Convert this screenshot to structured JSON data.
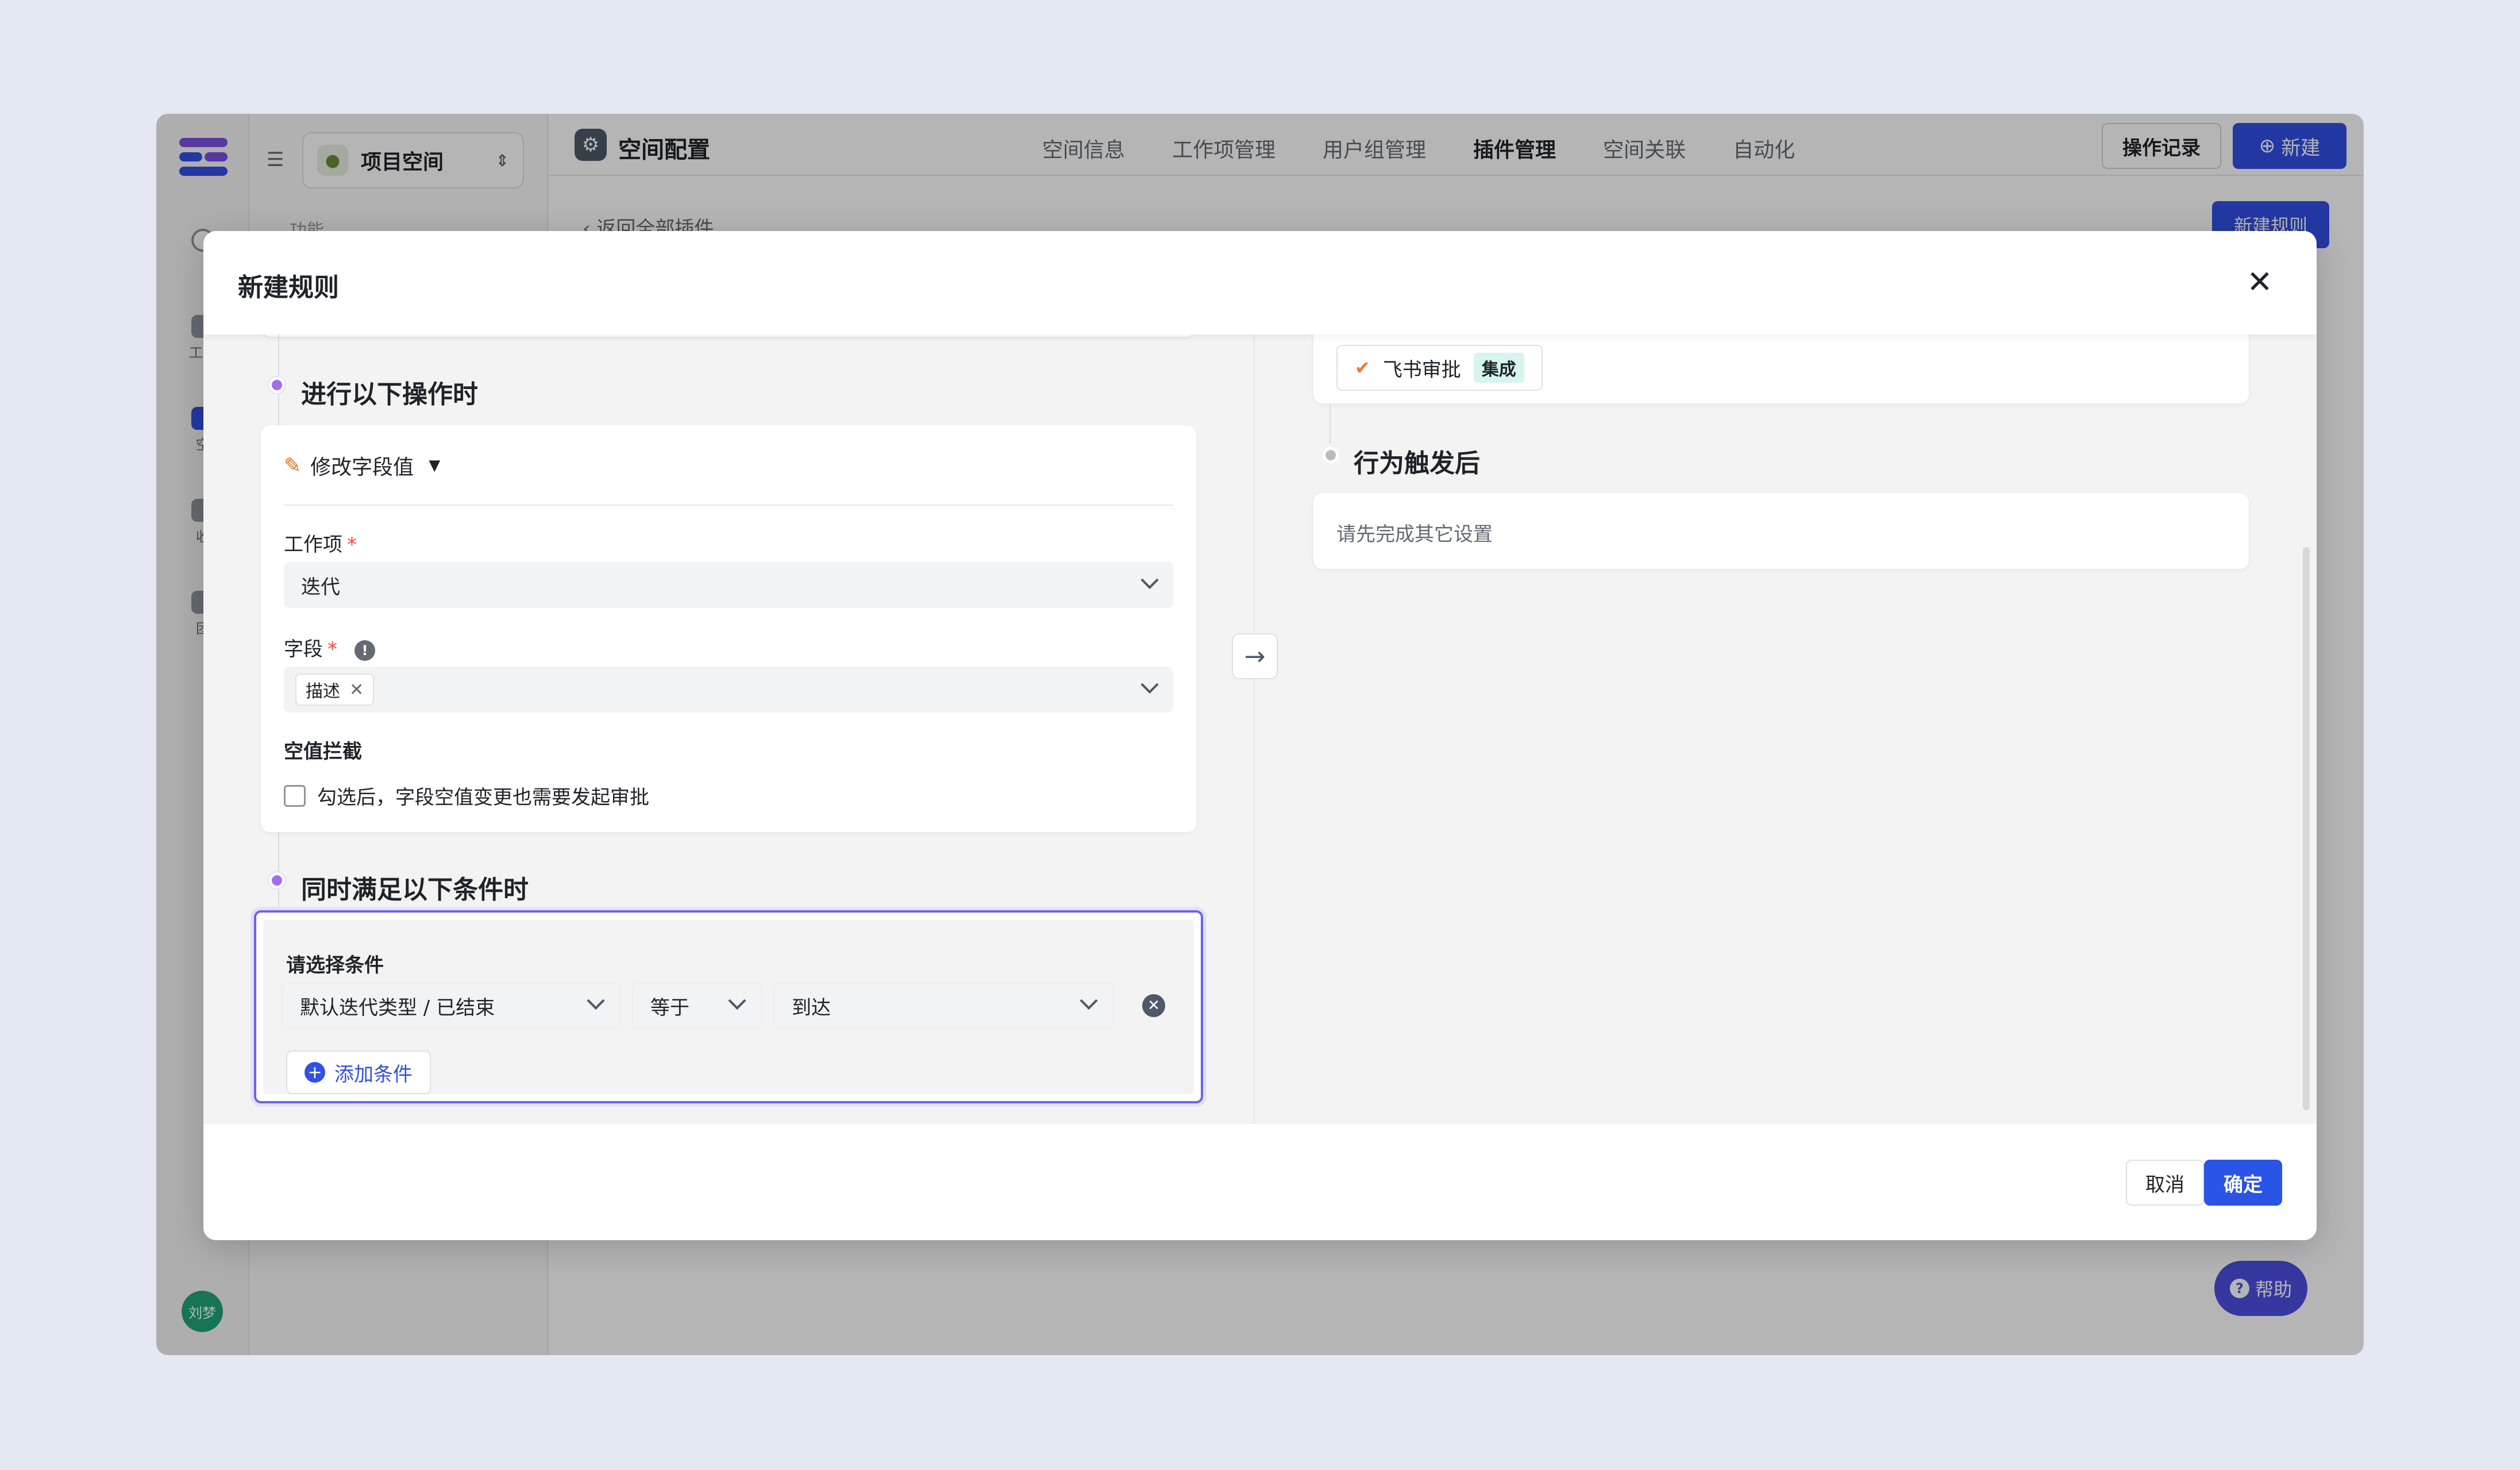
{
  "app": {
    "page_title": "空间配置",
    "space_name": "项目空间",
    "side_label": "功能",
    "rail_items": [
      {
        "label": "工作"
      },
      {
        "label": "空"
      },
      {
        "label": "收"
      },
      {
        "label": "团"
      }
    ],
    "avatar_text": "刘梦",
    "nav": [
      {
        "label": "空间信息"
      },
      {
        "label": "工作项管理"
      },
      {
        "label": "用户组管理"
      },
      {
        "label": "插件管理"
      },
      {
        "label": "空间关联"
      },
      {
        "label": "自动化"
      }
    ],
    "operation_log_label": "操作记录",
    "new_label": "新建",
    "back_label": "返回全部插件",
    "new_rule_label": "新建规则",
    "help_label": "帮助"
  },
  "modal": {
    "title": "新建规则",
    "close_glyph": "✕",
    "action_section_title": "进行以下操作时",
    "action_type": "修改字段值",
    "work_item_label": "工作项",
    "work_item_value": "迭代",
    "field_label": "字段",
    "field_tag": "描述",
    "empty_block_label": "空值拦截",
    "empty_block_checkbox": "勾选后，字段空值变更也需要发起审批",
    "condition_section_title": "同时满足以下条件时",
    "condition_label": "请选择条件",
    "condition_field": "默认迭代类型 / 已结束",
    "condition_operator": "等于",
    "condition_value": "到达",
    "add_condition_label": "添加条件",
    "trigger_name": "飞书审批",
    "trigger_badge": "集成",
    "after_section_title": "行为触发后",
    "after_placeholder": "请先完成其它设置",
    "cancel_label": "取消",
    "confirm_label": "确定"
  },
  "colors": {
    "primary": "#3250e6",
    "step_dot": "#a26cf0",
    "condition_border": "#6b62f0",
    "badge_bg": "#d6f5ee",
    "help_bg": "#4c4fe2"
  }
}
